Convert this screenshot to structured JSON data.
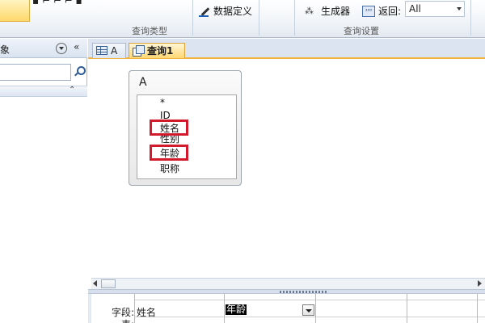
{
  "ribbon": {
    "groups": [
      {
        "label": "查询类型"
      },
      {
        "label": "查询设置"
      }
    ],
    "data_definition_label": "数据定义",
    "builder_label": "生成器",
    "return_label": "返回:",
    "return_value": "All",
    "return_icon_text": "¹⁰⁰"
  },
  "nav": {
    "title": "象",
    "collapse_glyph": "«",
    "group_chevron": "⌃"
  },
  "tabs": [
    {
      "label": "A"
    },
    {
      "label": "查询1"
    }
  ],
  "table": {
    "title": "A",
    "fields": [
      "*",
      "ID",
      "姓名",
      "性别",
      "年龄",
      "职称"
    ],
    "highlighted": [
      "姓名",
      "年龄"
    ]
  },
  "grid": {
    "row_labels": [
      "字段:",
      "表:"
    ],
    "cells": [
      "姓名",
      "年龄"
    ]
  },
  "colors": {
    "highlight_border": "#d31a2c",
    "active_tab": "#ffd774",
    "tab_underline": "#f2b43b"
  }
}
